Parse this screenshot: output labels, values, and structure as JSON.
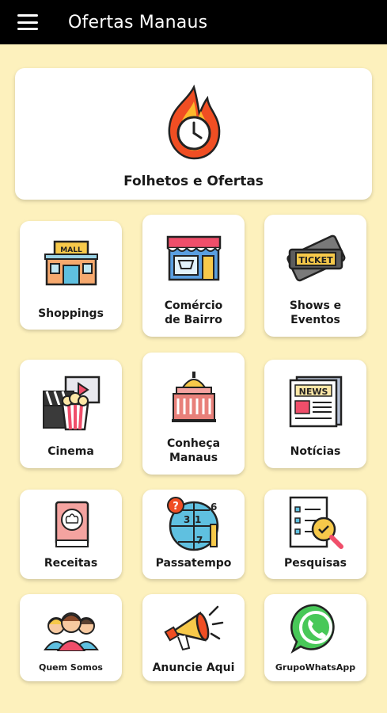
{
  "appbar": {
    "title": "Ofertas Manaus",
    "menu_icon": "hamburger-menu-icon"
  },
  "colors": {
    "background": "#fdf1bd",
    "appbar": "#000000",
    "card": "#ffffff"
  },
  "hero": {
    "label": "Folhetos e Ofertas",
    "icon": "flame-clock-icon"
  },
  "tiles": [
    {
      "label": "Shoppings",
      "icon": "mall-icon"
    },
    {
      "label": "Comércio de Bairro",
      "icon": "storefront-icon"
    },
    {
      "label": "Shows e Eventos",
      "icon": "ticket-icon"
    },
    {
      "label": "Cinema",
      "icon": "cinema-popcorn-icon"
    },
    {
      "label": "Conheça Manaus",
      "icon": "theater-building-icon"
    },
    {
      "label": "Notícias",
      "icon": "newspaper-icon"
    },
    {
      "label": "Receitas",
      "icon": "recipe-book-icon"
    },
    {
      "label": "Passatempo",
      "icon": "puzzle-globe-icon"
    },
    {
      "label": "Pesquisas",
      "icon": "survey-search-icon"
    },
    {
      "label": "Quem Somos",
      "icon": "team-icon"
    },
    {
      "label": "Anuncie Aqui",
      "icon": "megaphone-icon"
    },
    {
      "label": "GrupoWhatsApp",
      "icon": "whatsapp-icon"
    }
  ]
}
